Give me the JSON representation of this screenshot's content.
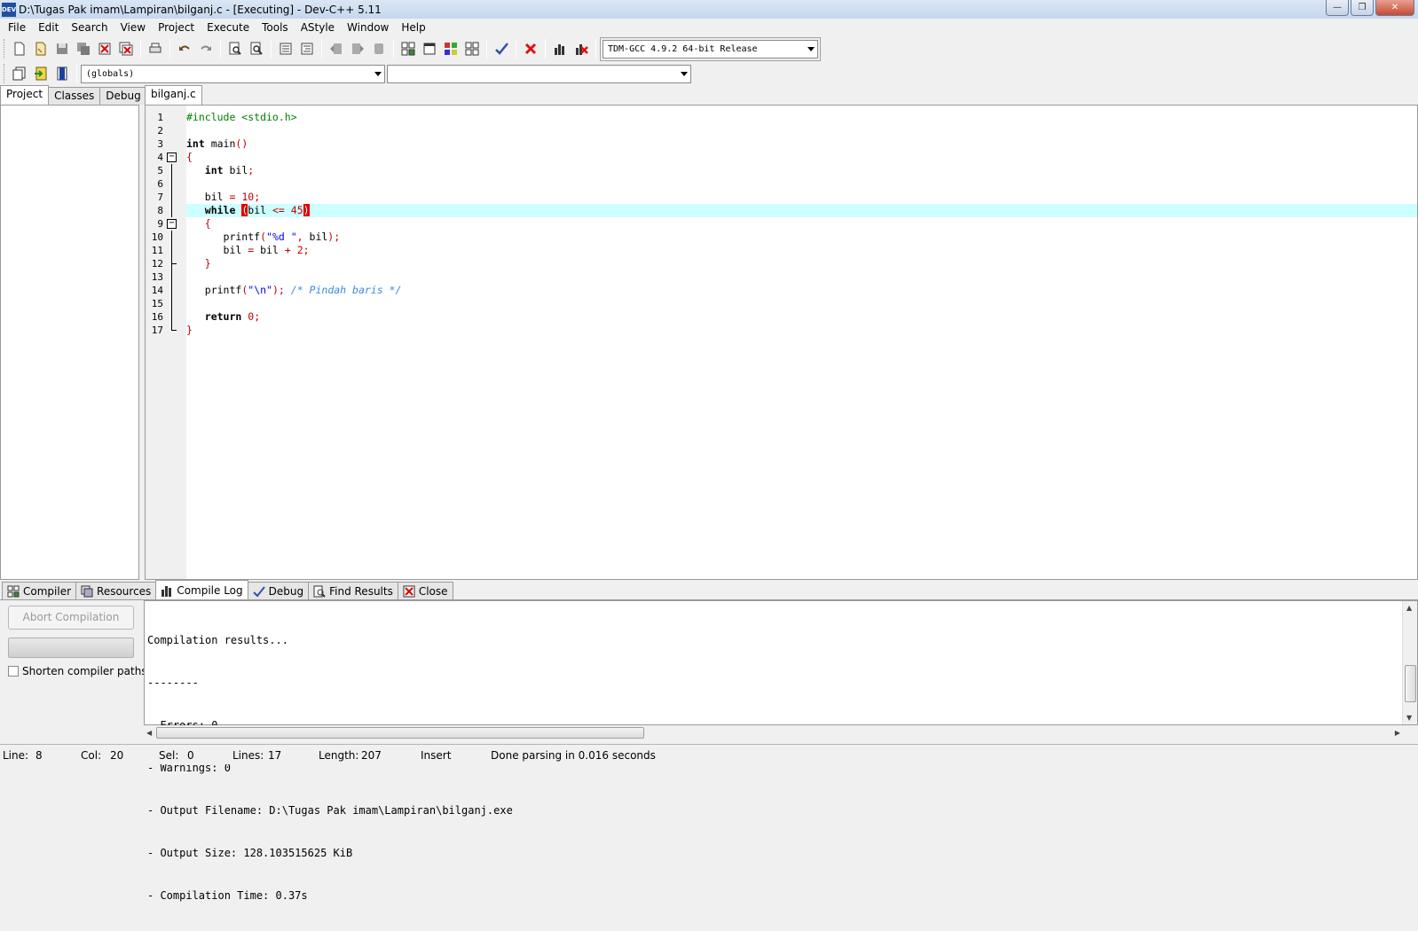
{
  "window": {
    "title": "D:\\Tugas Pak imam\\Lampiran\\bilganj.c - [Executing] - Dev-C++ 5.11",
    "app_icon_text": "DEV",
    "minimize": "—",
    "restore": "❐",
    "close": "✕"
  },
  "menu": [
    "File",
    "Edit",
    "Search",
    "View",
    "Project",
    "Execute",
    "Tools",
    "AStyle",
    "Window",
    "Help"
  ],
  "toolbar": {
    "compiler_select": "TDM-GCC 4.9.2 64-bit Release",
    "scope_select": "(globals)",
    "member_select": ""
  },
  "left_tabs": [
    "Project",
    "Classes",
    "Debug"
  ],
  "editor": {
    "file_tab": "bilganj.c",
    "current_line": 8
  },
  "bottom_tabs": [
    "Compiler",
    "Resources",
    "Compile Log",
    "Debug",
    "Find Results",
    "Close"
  ],
  "compile_panel": {
    "abort_label": "Abort Compilation",
    "shorten_label": "Shorten compiler paths",
    "shorten_checked": false,
    "log": [
      "Compilation results...",
      "--------",
      "- Errors: 0",
      "- Warnings: 0",
      "- Output Filename: D:\\Tugas Pak imam\\Lampiran\\bilganj.exe",
      "- Output Size: 128.103515625 KiB",
      "- Compilation Time: 0.37s"
    ]
  },
  "status": {
    "line_label": "Line:",
    "line_value": "8",
    "col_label": "Col:",
    "col_value": "20",
    "sel_label": "Sel:",
    "sel_value": "0",
    "lines_label": "Lines:",
    "lines_value": "17",
    "length_label": "Length:",
    "length_value": "207",
    "mode": "Insert",
    "message": "Done parsing in 0.016 seconds"
  },
  "colors": {
    "current_line": "#ccffff",
    "keyword": "#000000",
    "preprocessor": "#008000",
    "number": "#c00000",
    "string": "#0000ff",
    "comment": "#3b8ae0",
    "brace_match": "#e00000"
  }
}
